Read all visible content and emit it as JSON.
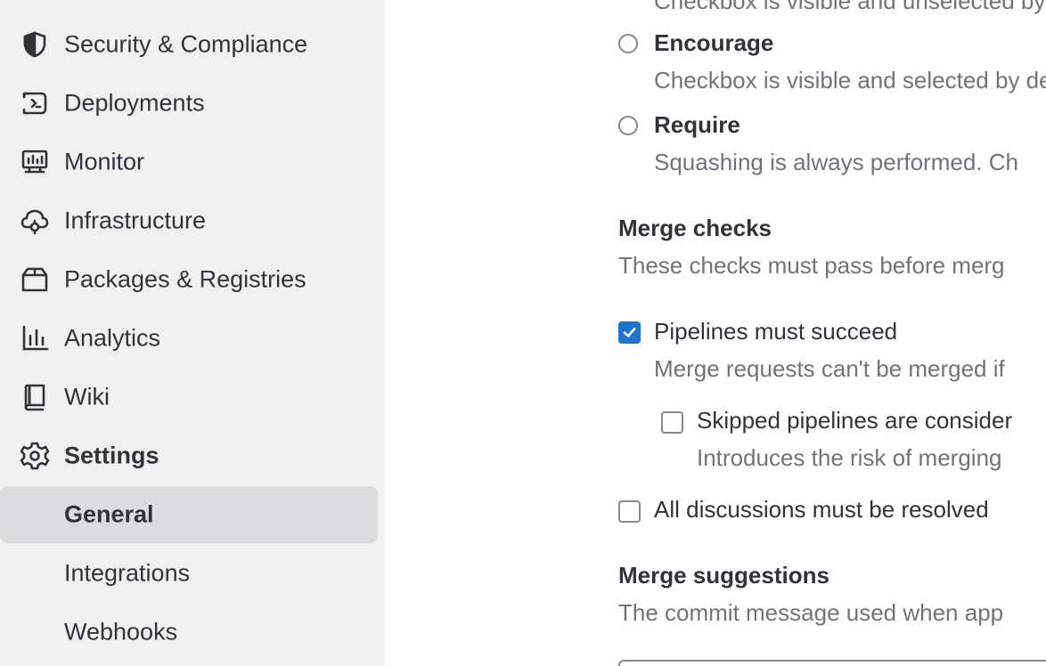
{
  "sidebar": {
    "items": [
      {
        "label": "Security & Compliance",
        "icon": "shield-icon"
      },
      {
        "label": "Deployments",
        "icon": "deployments-icon"
      },
      {
        "label": "Monitor",
        "icon": "monitor-icon"
      },
      {
        "label": "Infrastructure",
        "icon": "cloud-gear-icon"
      },
      {
        "label": "Packages & Registries",
        "icon": "package-icon"
      },
      {
        "label": "Analytics",
        "icon": "chart-icon"
      },
      {
        "label": "Wiki",
        "icon": "book-icon"
      },
      {
        "label": "Settings",
        "icon": "gear-icon"
      }
    ],
    "sub_items": [
      {
        "label": "General",
        "active": true
      },
      {
        "label": "Integrations",
        "active": false
      },
      {
        "label": "Webhooks",
        "active": false
      }
    ]
  },
  "main": {
    "squash_top_desc": "Checkbox is visible and unselected by default.",
    "squash_options": [
      {
        "label": "Encourage",
        "desc": "Checkbox is visible and selected by default."
      },
      {
        "label": "Require",
        "desc": "Squashing is always performed. Ch"
      }
    ],
    "merge_checks": {
      "title": "Merge checks",
      "desc": "These checks must pass before merg",
      "pipelines": {
        "label": "Pipelines must succeed",
        "desc": "Merge requests can't be merged if",
        "checked": true
      },
      "skipped": {
        "label": "Skipped pipelines are consider",
        "desc": "Introduces the risk of merging",
        "checked": false
      },
      "discussions": {
        "label": "All discussions must be resolved",
        "checked": false
      }
    },
    "merge_suggestions": {
      "title": "Merge suggestions",
      "desc": "The commit message used when app"
    }
  },
  "colors": {
    "sidebar_bg": "#f0f0f0",
    "active_bg": "#dcdcde",
    "checkbox_checked": "#1f75cb",
    "muted_text": "#737278",
    "text": "#333238"
  }
}
